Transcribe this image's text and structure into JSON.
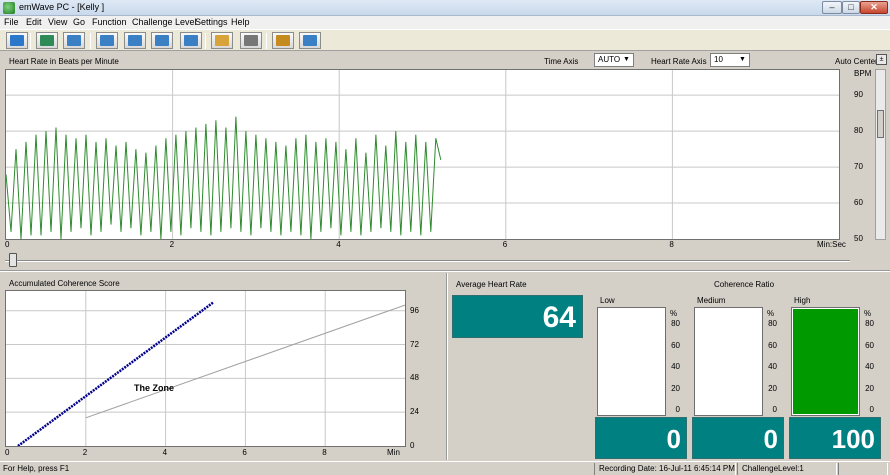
{
  "window": {
    "title": "emWave PC - [Kelly ]",
    "min_glyph": "–",
    "max_glyph": "□",
    "close_glyph": "✕"
  },
  "menu": [
    "File",
    "Edit",
    "View",
    "Go",
    "Function",
    "Challenge Level",
    "Settings",
    "Help"
  ],
  "toolbar": [
    {
      "name": "home-button",
      "icon": "home-icon",
      "color": "#2b77c9"
    },
    {
      "name": "pacer-button",
      "icon": "pacer-icon",
      "color": "#2e8b57"
    },
    {
      "name": "waveform-button",
      "icon": "waveform-icon",
      "color": "#3b7fc4"
    },
    {
      "name": "hrv-graph-button",
      "icon": "hrv-graph-icon",
      "color": "#3b7fc4"
    },
    {
      "name": "bar-chart-button",
      "icon": "bar-chart-icon",
      "color": "#3b7fc4"
    },
    {
      "name": "spectrum-button",
      "icon": "spectrum-icon",
      "color": "#3b7fc4"
    },
    {
      "name": "trend-button",
      "icon": "trend-icon",
      "color": "#3b7fc4"
    },
    {
      "name": "open-button",
      "icon": "folder-icon",
      "color": "#d8a43a"
    },
    {
      "name": "print-button",
      "icon": "printer-icon",
      "color": "#777777"
    },
    {
      "name": "sensor-button",
      "icon": "sensor-icon",
      "color": "#c58b1f"
    },
    {
      "name": "help-button",
      "icon": "help-icon",
      "color": "#3b7fc4"
    }
  ],
  "hr_panel": {
    "title": "Heart Rate in Beats per Minute",
    "time_axis_label": "Time Axis",
    "time_axis_value": "AUTO",
    "hr_axis_label": "Heart Rate Axis",
    "hr_axis_value": "10",
    "auto_center_label": "Auto Center",
    "auto_center_glyph": "±",
    "x_unit": "Min:Sec",
    "y_unit": "BPM",
    "line_color": "#2e8b2e"
  },
  "coherence_panel": {
    "title": "Accumulated Coherence Score",
    "zone_label": "The Zone",
    "x_unit": "Min"
  },
  "stats": {
    "avg_title": "Average Heart Rate",
    "avg_value": "64",
    "coherence_title": "Coherence Ratio",
    "pct_symbol": "%",
    "columns": [
      {
        "label": "Low",
        "value": "0",
        "fill_pct": 0
      },
      {
        "label": "Medium",
        "value": "0",
        "fill_pct": 0
      },
      {
        "label": "High",
        "value": "100",
        "fill_pct": 100
      }
    ],
    "pct_ticks": [
      "80",
      "60",
      "40",
      "20",
      "0"
    ],
    "panel_color": "#008080",
    "high_color": "#009a00"
  },
  "status": {
    "help_text": "For Help, press F1",
    "recording_date": "Recording Date: 16-Jul-11 6:45:14 PM",
    "challenge_level": "ChallengeLevel:1"
  },
  "chart_data": [
    {
      "type": "line",
      "title": "Heart Rate in Beats per Minute",
      "xlabel": "Min:Sec",
      "ylabel": "BPM",
      "xlim": [
        0,
        10
      ],
      "ylim": [
        50,
        97
      ],
      "x_ticks": [
        "0",
        "2",
        "4",
        "6",
        "8"
      ],
      "y_ticks": [
        "90",
        "80",
        "70",
        "60",
        "50"
      ],
      "grid": true,
      "series": [
        {
          "x": [
            0,
            0.06,
            0.12,
            0.18,
            0.24,
            0.3,
            0.36,
            0.42,
            0.48,
            0.54,
            0.6,
            0.66,
            0.72,
            0.78,
            0.84,
            0.9,
            0.96,
            1.02,
            1.08,
            1.14,
            1.2,
            1.26,
            1.32,
            1.38,
            1.44,
            1.5,
            1.56,
            1.62,
            1.68,
            1.74,
            1.8,
            1.86,
            1.92,
            1.98,
            2.04,
            2.1,
            2.16,
            2.22,
            2.28,
            2.34,
            2.4,
            2.46,
            2.52,
            2.58,
            2.64,
            2.7,
            2.76,
            2.82,
            2.88,
            2.94,
            3.0,
            3.06,
            3.12,
            3.18,
            3.24,
            3.3,
            3.36,
            3.42,
            3.48,
            3.54,
            3.6,
            3.66,
            3.72,
            3.78,
            3.84,
            3.9,
            3.96,
            4.02,
            4.08,
            4.14,
            4.2,
            4.26,
            4.32,
            4.38,
            4.44,
            4.5,
            4.56,
            4.62,
            4.68,
            4.74,
            4.8,
            4.86,
            4.92,
            4.98,
            5.04,
            5.1,
            5.16,
            5.22
          ],
          "y": [
            68,
            52,
            75,
            50,
            77,
            51,
            79,
            51,
            80,
            52,
            81,
            50,
            79,
            52,
            78,
            53,
            79,
            51,
            77,
            52,
            78,
            54,
            76,
            52,
            77,
            53,
            75,
            51,
            74,
            52,
            76,
            50,
            78,
            52,
            79,
            51,
            80,
            53,
            81,
            52,
            82,
            51,
            83,
            52,
            81,
            53,
            84,
            52,
            80,
            51,
            79,
            53,
            78,
            52,
            77,
            51,
            76,
            52,
            78,
            51,
            79,
            50,
            77,
            52,
            78,
            53,
            77,
            51,
            75,
            52,
            78,
            51,
            74,
            52,
            79,
            53,
            76,
            52,
            80,
            51,
            77,
            52,
            79,
            51,
            77,
            52,
            78,
            72
          ]
        }
      ]
    },
    {
      "type": "line",
      "title": "Accumulated Coherence Score",
      "xlabel": "Min",
      "ylabel": "",
      "xlim": [
        0,
        10
      ],
      "ylim": [
        0,
        110
      ],
      "x_ticks": [
        "0",
        "2",
        "4",
        "6",
        "8"
      ],
      "y_ticks": [
        "96",
        "72",
        "48",
        "24",
        "0"
      ],
      "grid": true,
      "series": [
        {
          "x": [
            0.3,
            5.2
          ],
          "y": [
            0,
            102
          ],
          "color": "#00008b",
          "style": "dotted-thick"
        },
        {
          "x": [
            2.0,
            10.0
          ],
          "y": [
            20,
            100
          ],
          "color": "#a0a0a0",
          "style": "thin"
        }
      ]
    }
  ]
}
